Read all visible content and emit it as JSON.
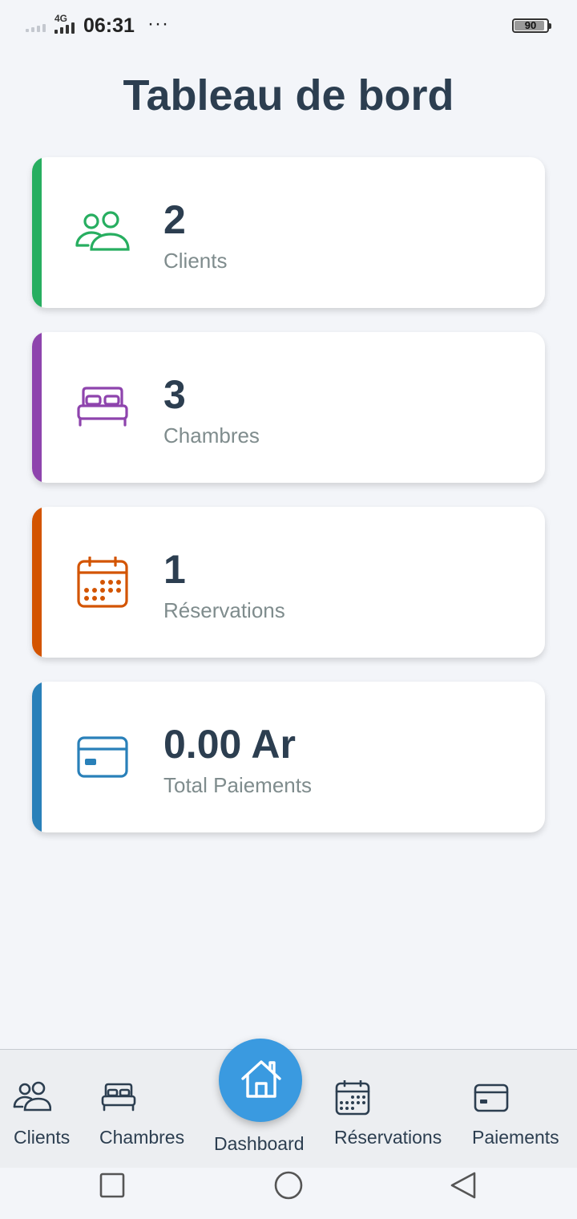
{
  "status_bar": {
    "network": "4G",
    "time": "06:31",
    "more": "···",
    "battery": "90"
  },
  "title": "Tableau de bord",
  "cards": [
    {
      "value": "2",
      "label": "Clients",
      "icon": "users-icon",
      "accent": "#27ae60"
    },
    {
      "value": "3",
      "label": "Chambres",
      "icon": "bed-icon",
      "accent": "#8e44ad"
    },
    {
      "value": "1",
      "label": "Réservations",
      "icon": "calendar-icon",
      "accent": "#d35400"
    },
    {
      "value": "0.00 Ar",
      "label": "Total Paiements",
      "icon": "credit-card-icon",
      "accent": "#2980b9"
    }
  ],
  "bottom_nav": {
    "items": [
      {
        "label": "Clients",
        "icon": "users-icon"
      },
      {
        "label": "Chambres",
        "icon": "bed-icon"
      },
      {
        "label": "Dashboard",
        "icon": "home-icon",
        "active": true
      },
      {
        "label": "Réservations",
        "icon": "calendar-icon"
      },
      {
        "label": "Paiements",
        "icon": "credit-card-icon"
      }
    ],
    "active_color": "#3a9ae0"
  },
  "system_nav": {
    "buttons": [
      "recents-button",
      "home-button",
      "back-button"
    ]
  }
}
